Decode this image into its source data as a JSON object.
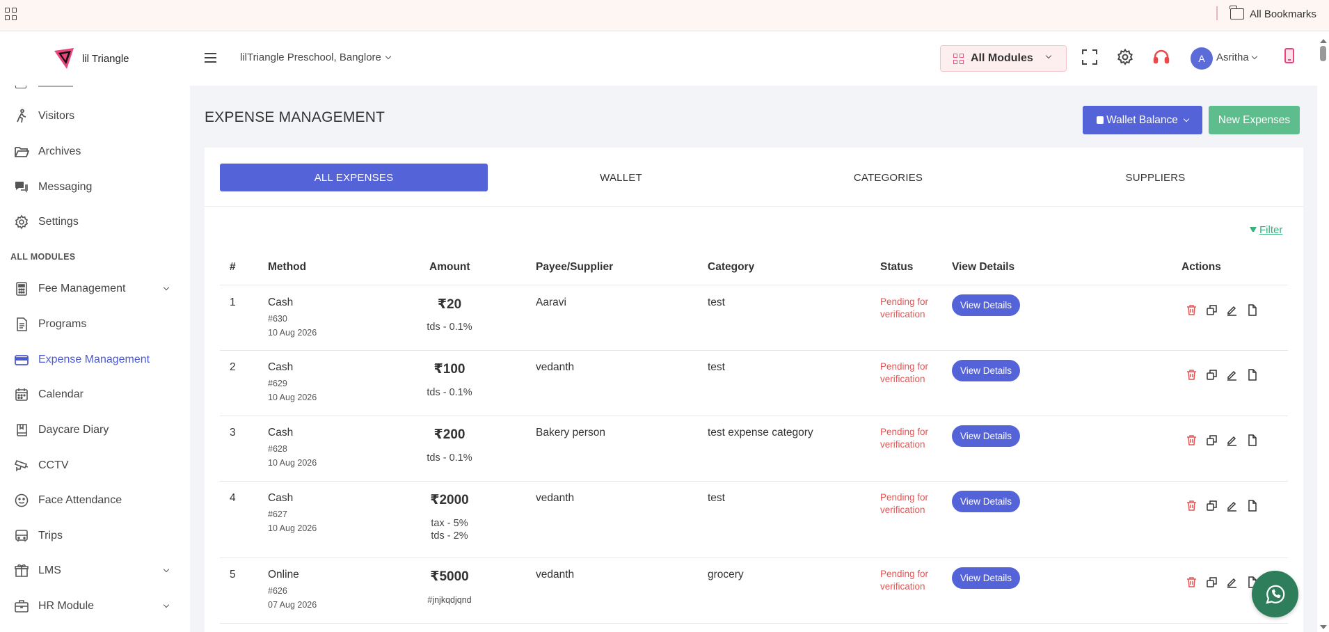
{
  "bookmarks": {
    "all_bookmarks_label": "All Bookmarks"
  },
  "header": {
    "logo_text": "lil Triangle",
    "school_name": "lilTriangle Preschool, Banglore",
    "modules_label": "All Modules",
    "avatar_initial": "A",
    "user_name": "Asritha"
  },
  "sidebar": {
    "items_top": [
      {
        "label": "Visitors",
        "icon": "walking-person-icon"
      },
      {
        "label": "Archives",
        "icon": "folder-open-icon"
      },
      {
        "label": "Messaging",
        "icon": "chat-bubbles-icon"
      },
      {
        "label": "Settings",
        "icon": "gear-icon"
      }
    ],
    "section_title": "ALL MODULES",
    "modules": [
      {
        "label": "Fee Management",
        "icon": "calculator-icon",
        "expandable": true
      },
      {
        "label": "Programs",
        "icon": "document-icon"
      },
      {
        "label": "Expense Management",
        "icon": "credit-card-icon",
        "active": true
      },
      {
        "label": "Calendar",
        "icon": "calendar-icon"
      },
      {
        "label": "Daycare Diary",
        "icon": "book-icon"
      },
      {
        "label": "CCTV",
        "icon": "cctv-camera-icon"
      },
      {
        "label": "Face Attendance",
        "icon": "face-icon"
      },
      {
        "label": "Trips",
        "icon": "bus-icon"
      },
      {
        "label": "LMS",
        "icon": "box-icon",
        "expandable": true
      },
      {
        "label": "HR Module",
        "icon": "briefcase-icon",
        "expandable": true
      }
    ]
  },
  "main": {
    "title": "EXPENSE MANAGEMENT",
    "wallet_balance_label": "Wallet Balance",
    "new_expenses_label": "New Expenses",
    "tabs": [
      "ALL EXPENSES",
      "WALLET",
      "CATEGORIES",
      "SUPPLIERS"
    ],
    "active_tab": "ALL EXPENSES",
    "filter_label": "Filter",
    "columns": [
      "#",
      "Method",
      "Amount",
      "Payee/Supplier",
      "Category",
      "Status",
      "View Details",
      "Actions"
    ],
    "view_details_label": "View Details",
    "rows": [
      {
        "num": "1",
        "method": "Cash",
        "ref": "#630",
        "date": "10 Aug 2026",
        "amount": "₹20",
        "notes": [
          "tds - 0.1%"
        ],
        "payee": "Aaravi",
        "category": "test",
        "status_line1": "Pending for",
        "status_line2": "verification"
      },
      {
        "num": "2",
        "method": "Cash",
        "ref": "#629",
        "date": "10 Aug 2026",
        "amount": "₹100",
        "notes": [
          "tds - 0.1%"
        ],
        "payee": "vedanth",
        "category": "test",
        "status_line1": "Pending for",
        "status_line2": "verification"
      },
      {
        "num": "3",
        "method": "Cash",
        "ref": "#628",
        "date": "10 Aug 2026",
        "amount": "₹200",
        "notes": [
          "tds - 0.1%"
        ],
        "payee": "Bakery person",
        "category": "test expense category",
        "status_line1": "Pending for",
        "status_line2": "verification"
      },
      {
        "num": "4",
        "method": "Cash",
        "ref": "#627",
        "date": "10 Aug 2026",
        "amount": "₹2000",
        "notes": [
          "tax - 5%",
          "tds - 2%"
        ],
        "payee": "vedanth",
        "category": "test",
        "status_line1": "Pending for",
        "status_line2": "verification"
      },
      {
        "num": "5",
        "method": "Online",
        "ref": "#626",
        "date": "07 Aug 2026",
        "amount": "₹5000",
        "notes": [
          "#jnjkqdjqnd"
        ],
        "payee": "vedanth",
        "category": "grocery",
        "status_line1": "Pending for",
        "status_line2": "verification"
      }
    ]
  },
  "colors": {
    "primary": "#5563d8",
    "success": "#5dbd8d",
    "danger": "#e05656",
    "brand_pink": "#e8457b"
  }
}
